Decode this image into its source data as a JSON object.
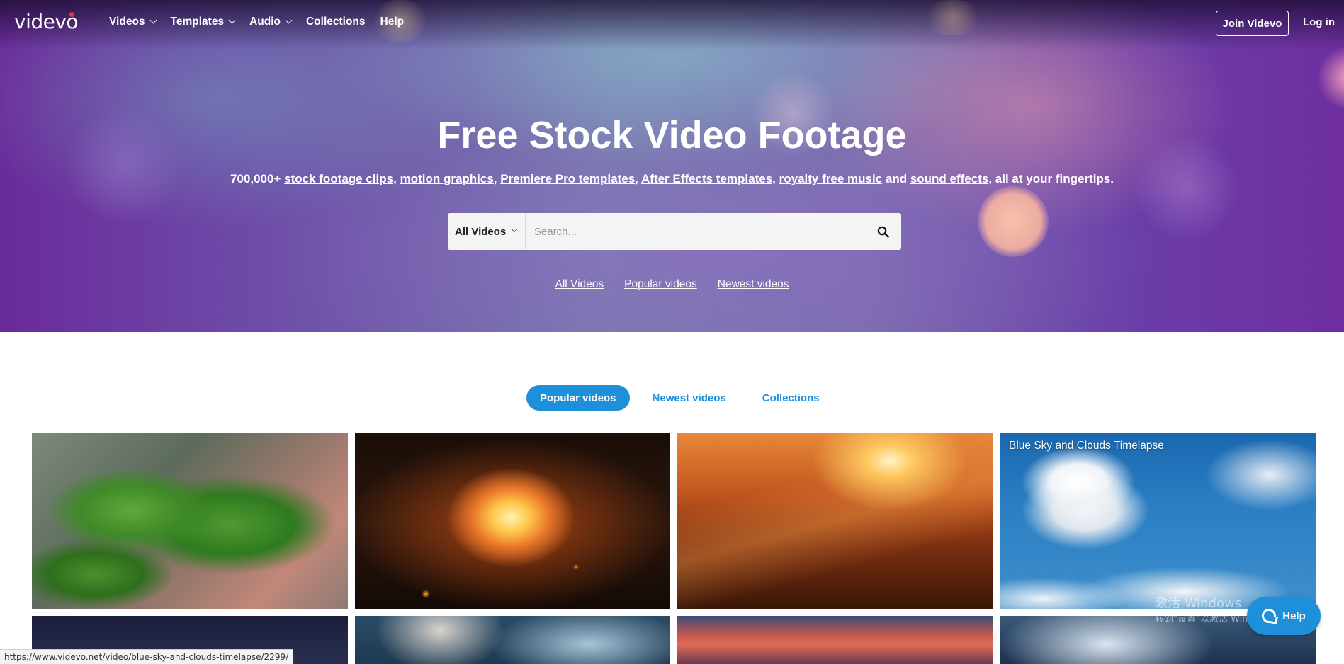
{
  "nav": {
    "logo": "videvo",
    "items": [
      {
        "label": "Videos",
        "dropdown": true
      },
      {
        "label": "Templates",
        "dropdown": true
      },
      {
        "label": "Audio",
        "dropdown": true
      },
      {
        "label": "Collections",
        "dropdown": false
      },
      {
        "label": "Help",
        "dropdown": false
      }
    ],
    "join_label": "Join Videvo",
    "login_label": "Log in"
  },
  "hero": {
    "title": "Free Stock Video Footage",
    "subtitle": {
      "prefix": "700,000+ ",
      "link1": "stock footage clips",
      "sep1": ", ",
      "link2": "motion graphics",
      "sep2": ", ",
      "link3": "Premiere Pro templates",
      "sep3": ", ",
      "link4": "After Effects templates",
      "sep4": ", ",
      "link5": "royalty free music",
      "and": " and ",
      "link6": "sound effects",
      "suffix": ", all at your fingertips."
    },
    "search": {
      "category": "All Videos",
      "placeholder": "Search...",
      "icon": "search-icon"
    },
    "quick_links": [
      "All Videos",
      "Popular videos",
      "Newest videos"
    ]
  },
  "tabs": {
    "active": "Popular videos",
    "items": [
      "Newest videos",
      "Collections"
    ]
  },
  "videos": {
    "hover_title": "Blue Sky and Clouds Timelapse"
  },
  "status_bar": {
    "url": "https://www.videvo.net/video/blue-sky-and-clouds-timelapse/2299/"
  },
  "watermark": {
    "line1": "激活 Windows",
    "line2": "转到\"设置\"以激活 Windows。"
  },
  "help_widget": {
    "label": "Help"
  },
  "colors": {
    "accent": "#1e8fd9",
    "logo_dot": "#e8343c"
  }
}
